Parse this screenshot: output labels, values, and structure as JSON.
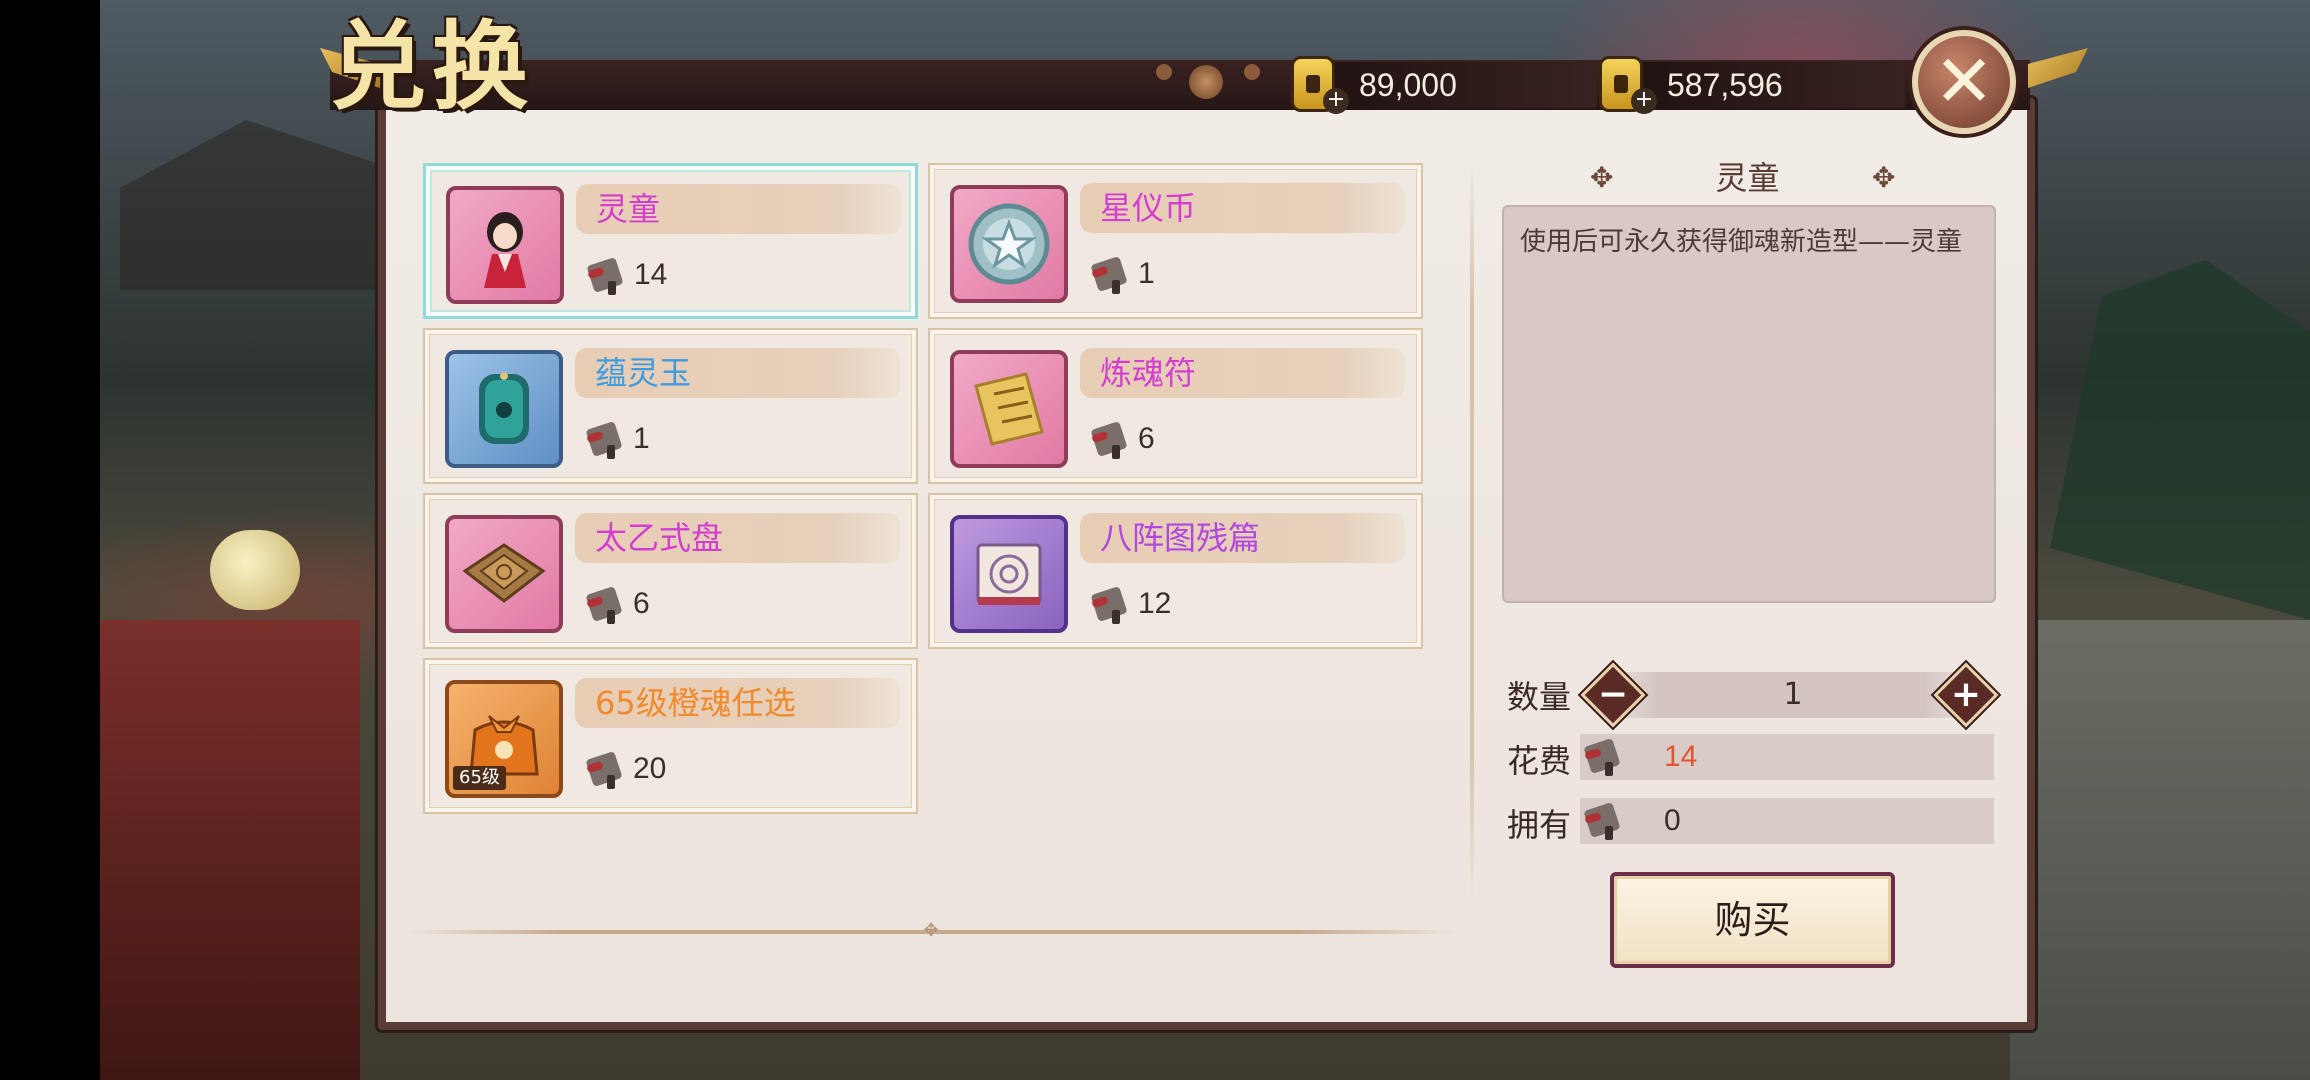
{
  "header": {
    "title": "兑换",
    "currency_1": "89,000",
    "currency_2": "587,596",
    "close_symbol": "✕"
  },
  "items": [
    {
      "name": "灵童",
      "price": "14",
      "name_color": "#d23fd0",
      "frame": "pink",
      "art": "girl-icon"
    },
    {
      "name": "星仪币",
      "price": "1",
      "name_color": "#d23fd0",
      "frame": "pink",
      "art": "star-coin-icon"
    },
    {
      "name": "蕴灵玉",
      "price": "1",
      "name_color": "#3d9be0",
      "frame": "blue",
      "art": "jade-icon"
    },
    {
      "name": "炼魂符",
      "price": "6",
      "name_color": "#d23fd0",
      "frame": "pink",
      "art": "talisman-icon"
    },
    {
      "name": "太乙式盘",
      "price": "6",
      "name_color": "#d23fd0",
      "frame": "pink",
      "art": "divination-board-icon"
    },
    {
      "name": "八阵图残篇",
      "price": "12",
      "name_color": "#b048e0",
      "frame": "purple",
      "art": "scroll-map-icon"
    },
    {
      "name": "65级橙魂任选",
      "price": "20",
      "name_color": "#f08a2c",
      "frame": "orange",
      "art": "bag-icon",
      "tag": "65级"
    }
  ],
  "detail": {
    "title": "灵童",
    "deco": "✥",
    "description": "使用后可永久获得御魂新造型——灵童"
  },
  "purchase": {
    "qty_label": "数量",
    "qty_value": "1",
    "minus": "−",
    "plus": "+",
    "cost_label": "花费",
    "cost_value": "14",
    "own_label": "拥有",
    "own_value": "0",
    "buy_label": "购买"
  },
  "colors": {
    "cost_value": "#e0552e",
    "own_value": "#3a2e2b"
  }
}
